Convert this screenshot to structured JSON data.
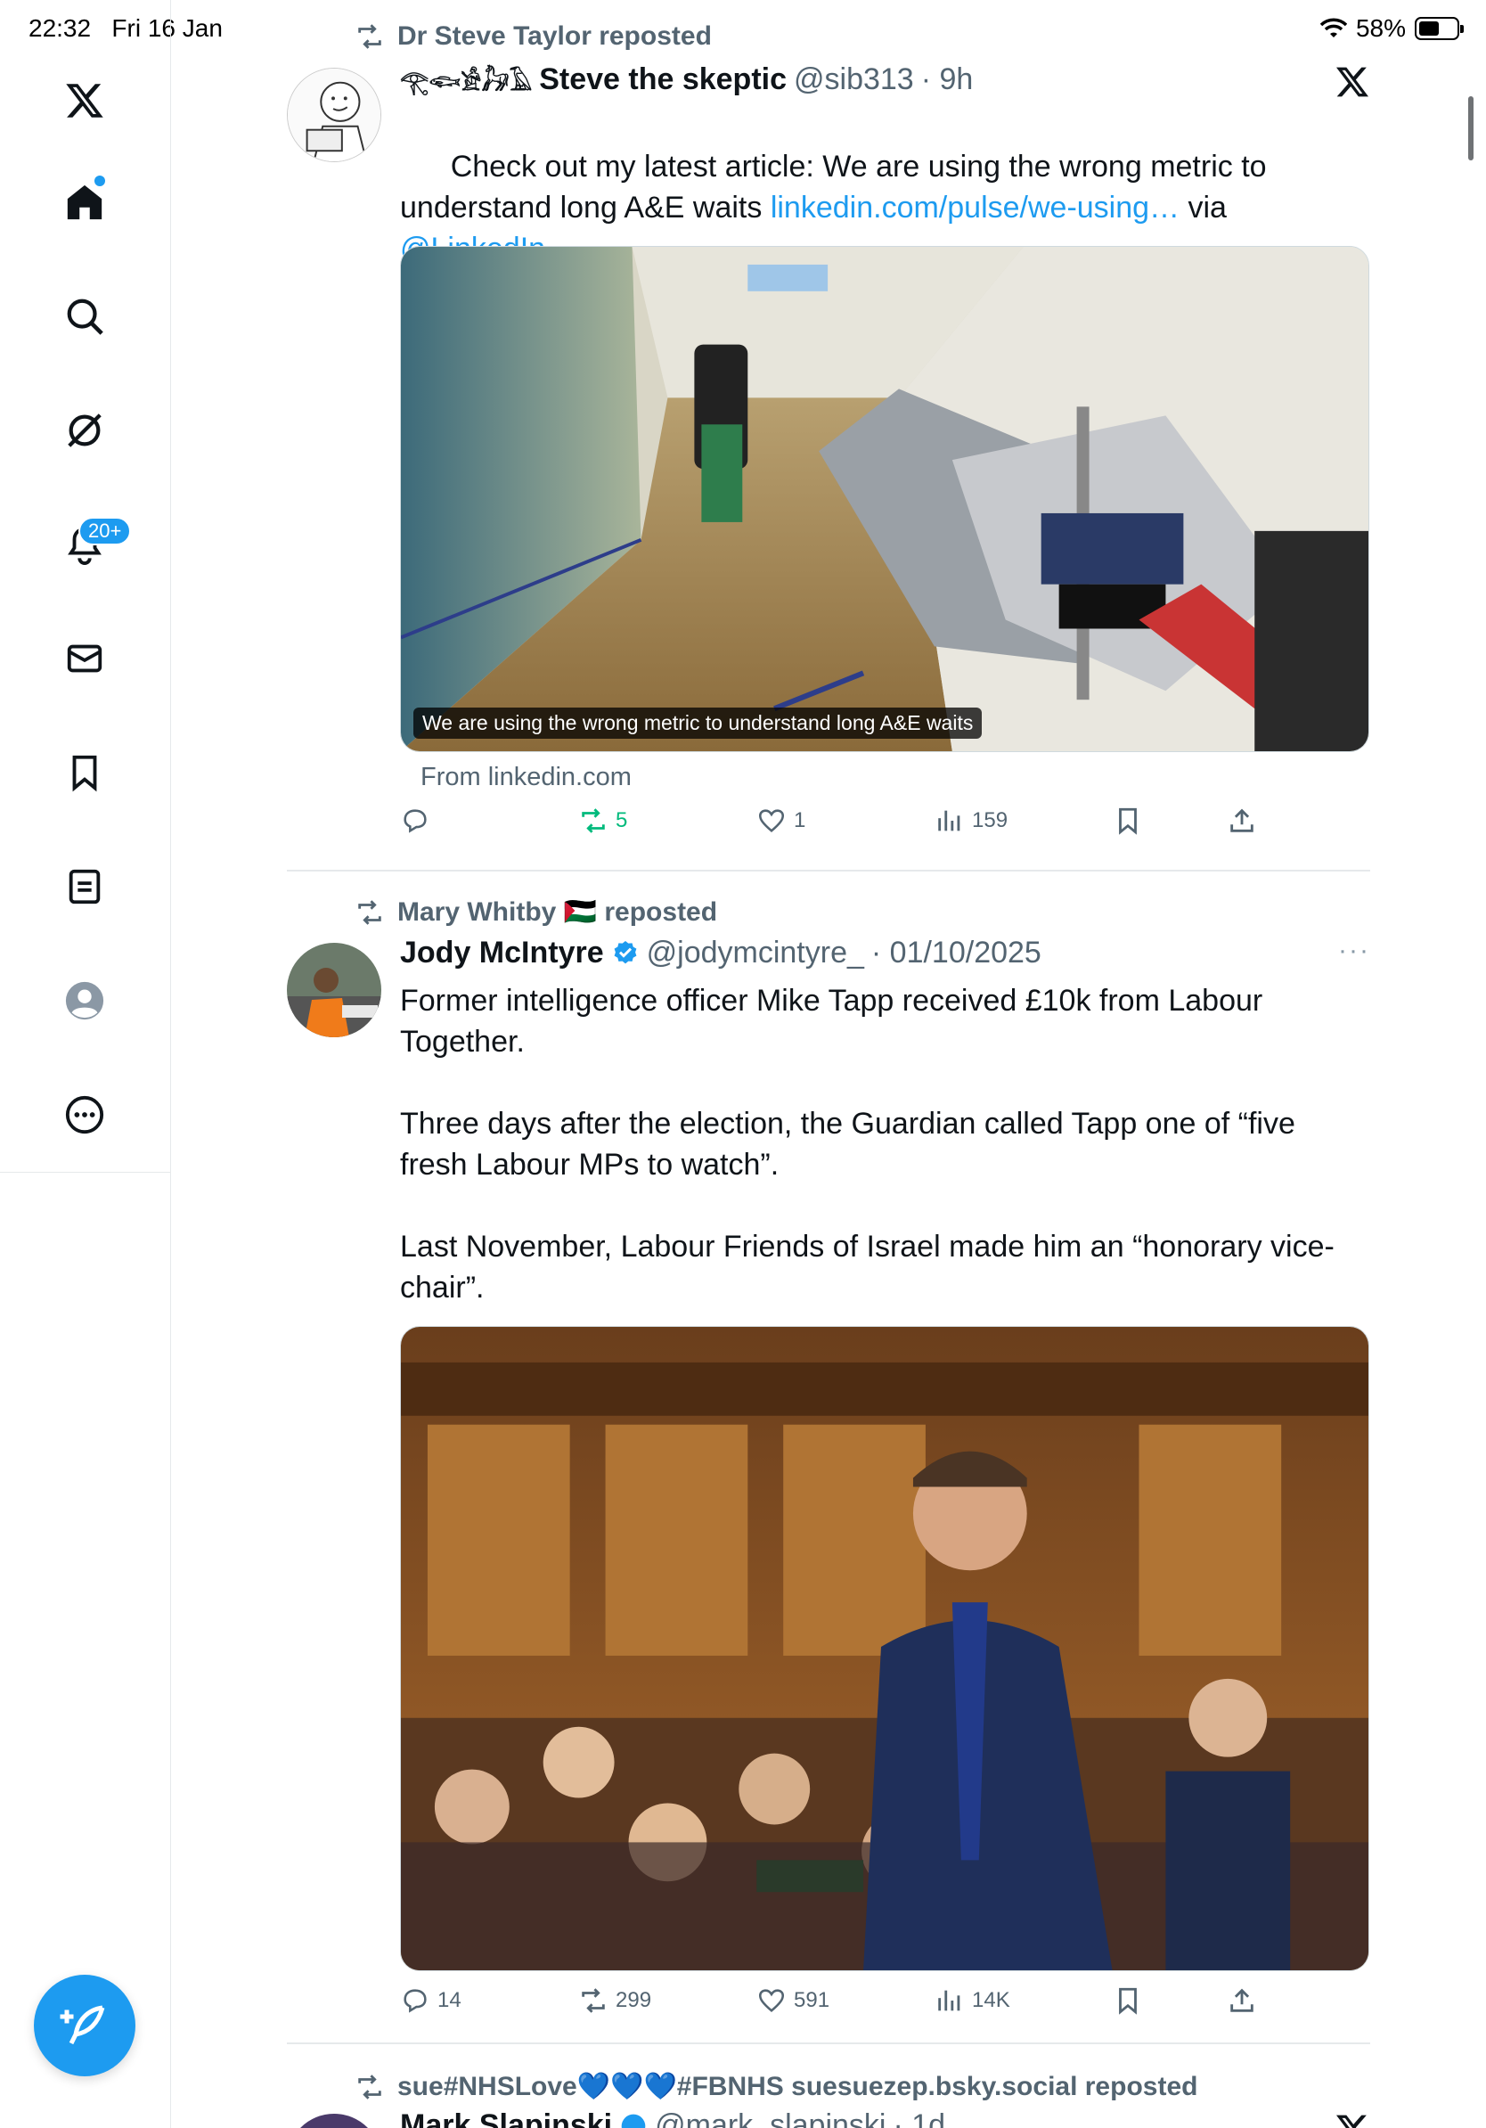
{
  "status_bar": {
    "time": "22:32",
    "date": "Fri 16 Jan",
    "battery": "58%"
  },
  "sidebar": {
    "notifications_badge": "20+",
    "items": [
      {
        "name": "x-logo-icon"
      },
      {
        "name": "home-icon"
      },
      {
        "name": "search-icon"
      },
      {
        "name": "grok-icon"
      },
      {
        "name": "notifications-icon"
      },
      {
        "name": "messages-icon"
      },
      {
        "name": "bookmarks-icon"
      },
      {
        "name": "lists-icon"
      },
      {
        "name": "profile-icon"
      },
      {
        "name": "more-icon"
      }
    ]
  },
  "tweets": [
    {
      "repost_by": "Dr Steve Taylor reposted",
      "name_prefix": "𓂀𓆟𓀀𓃗𓄿",
      "name": "Steve the skeptic",
      "handle": "@sib313",
      "time": "· 9h",
      "text_1": "Check out my latest article: We are using the wrong metric to understand long A&E waits ",
      "link": "linkedin.com/pulse/we-using…",
      "text_2": " via",
      "mention": "@LinkedIn",
      "media_caption": "We are using the wrong metric to understand long A&E waits",
      "from": "From linkedin.com",
      "replies": "",
      "reposts": "5",
      "likes": "1",
      "views": "159"
    },
    {
      "repost_by": "Mary Whitby 🇵🇸 reposted",
      "name": "Jody McIntyre",
      "handle": "@jodymcintyre_",
      "time": "· 01/10/2025",
      "text": "Former intelligence officer Mike Tapp received £10k from Labour Together.\n\nThree days after the election, the Guardian called Tapp one of “five fresh Labour MPs to watch”.\n\nLast November, Labour Friends of Israel made him an “honorary vice-chair”.",
      "replies": "14",
      "reposts": "299",
      "likes": "591",
      "views": "14K"
    },
    {
      "repost_by": "sue#NHSLove💙💙💙#FBNHS suesuezep.bsky.social reposted",
      "name": "Mark Slapinski",
      "handle": "@mark_slapinski",
      "time": "· 1d"
    }
  ]
}
